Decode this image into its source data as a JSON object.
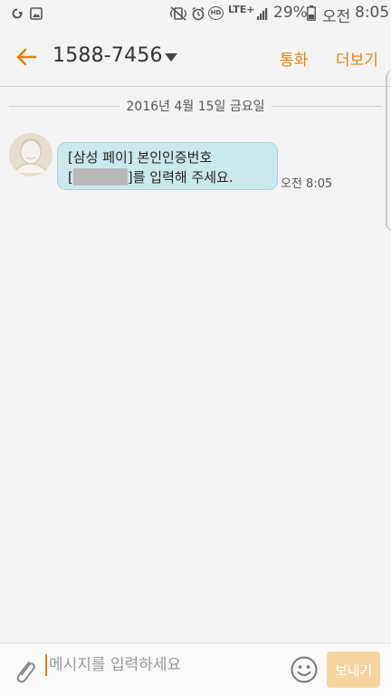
{
  "status_bar": {
    "battery_percent": "29%",
    "ampm": "오전",
    "time": "8:05",
    "network_label": "LTE+",
    "hd_label": "HD"
  },
  "header": {
    "title": "1588-7456",
    "call_label": "통화",
    "more_label": "더보기"
  },
  "conversation": {
    "date_separator": "2016년 4월 15일 금요일",
    "messages": [
      {
        "line1": "[삼성 페이] 본인인증번호",
        "bracket_open": "[",
        "line2_after": "]를 입력해 주세요.",
        "time": "오전 8:05"
      }
    ]
  },
  "composer": {
    "placeholder": "메시지를 입력하세요",
    "send_label": "보내기"
  },
  "colors": {
    "accent": "#e8800a",
    "bubble": "#cbe8ef",
    "send_button": "#f7d49f"
  }
}
